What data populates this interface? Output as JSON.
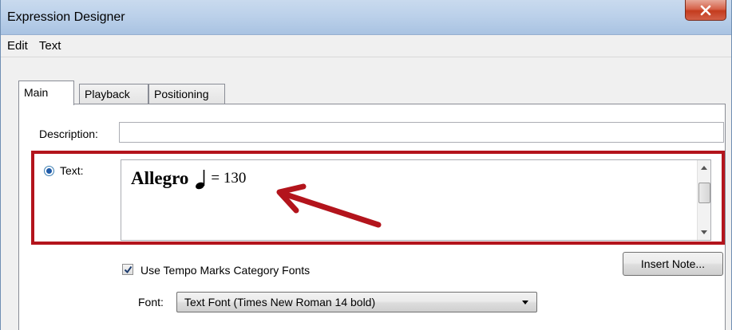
{
  "window": {
    "title": "Expression Designer"
  },
  "menu": {
    "items": [
      "Edit",
      "Text"
    ]
  },
  "tabs": [
    {
      "label": "Main",
      "active": true
    },
    {
      "label": "Playback",
      "active": false
    },
    {
      "label": "Positioning",
      "active": false
    }
  ],
  "main": {
    "description_label": "Description:",
    "description_value": "",
    "text_option_label": "Text:",
    "text_option_selected": true,
    "text_content": {
      "tempo_word": "Allegro",
      "note_icon": "quarter-note-icon",
      "tempo_value": "= 130"
    },
    "use_category_fonts_label": "Use Tempo Marks Category Fonts",
    "use_category_fonts_checked": true,
    "insert_note_label": "Insert Note...",
    "font_label": "Font:",
    "font_value": "Text Font (Times New Roman 14 bold)"
  },
  "colors": {
    "highlight": "#b3141c",
    "arrow": "#b3141c",
    "close_button": "#c43c1e"
  }
}
